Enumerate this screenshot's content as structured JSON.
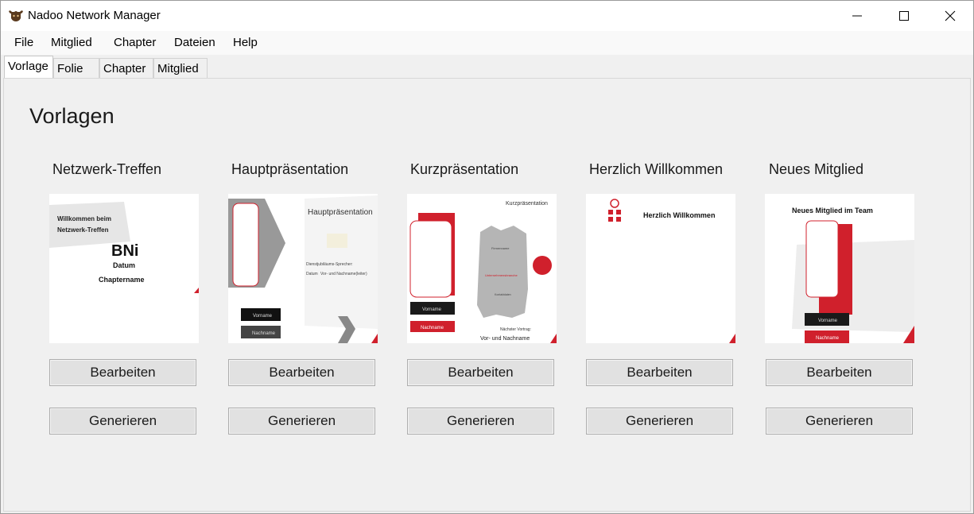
{
  "window": {
    "title": "Nadoo Network Manager",
    "controls": [
      "minimize-icon",
      "maximize-icon",
      "close-icon"
    ]
  },
  "menu": {
    "items": [
      "File",
      "Mitglied",
      "Chapter",
      "Dateien",
      "Help"
    ]
  },
  "tabs": [
    {
      "label": "Vorlage",
      "active": true
    },
    {
      "label": "Folie",
      "active": false
    },
    {
      "label": "Chapter",
      "active": false
    },
    {
      "label": "Mitglied",
      "active": false
    }
  ],
  "main": {
    "heading": "Vorlagen",
    "cards": [
      {
        "title": "Netzwerk-Treffen",
        "edit_label": "Bearbeiten",
        "generate_label": "Generieren",
        "preview": {
          "banner_line1": "Willkommen beim",
          "banner_line2": "Netzwerk-Treffen",
          "logo": "BNi",
          "line1": "Datum",
          "line2": "Chaptername"
        }
      },
      {
        "title": "Hauptpräsentation",
        "edit_label": "Bearbeiten",
        "generate_label": "Generieren",
        "preview": {
          "heading": "Hauptpräsentation",
          "speaker_label": "Dienstjubiläums-Sprecher:",
          "date_label": "Datum",
          "name_label": "Vor- und Nachname(leiter)",
          "first_name": "Vorname",
          "last_name": "Nachname"
        }
      },
      {
        "title": "Kurzpräsentation",
        "edit_label": "Bearbeiten",
        "generate_label": "Generieren",
        "preview": {
          "heading": "Kurzpräsentation",
          "company": "Firmenname",
          "category": "Unternehmensbranche",
          "contact": "Kontaktdaten",
          "first_name": "Vorname",
          "last_name": "Nachname",
          "next_label": "Nächster Vortrag:",
          "next_name": "Vor- und Nachname"
        }
      },
      {
        "title": "Herzlich Willkommen",
        "edit_label": "Bearbeiten",
        "generate_label": "Generieren",
        "preview": {
          "heading": "Herzlich Willkommen"
        }
      },
      {
        "title": "Neues Mitglied",
        "edit_label": "Bearbeiten",
        "generate_label": "Generieren",
        "preview": {
          "heading": "Neues Mitglied im Team",
          "first_name": "Vorname",
          "last_name": "Nachname"
        }
      }
    ]
  },
  "colors": {
    "accent_red": "#d0202c",
    "dark_gray": "#3a3a3a",
    "tab_bg": "#ffffff",
    "panel_bg": "#f0f0f0"
  }
}
